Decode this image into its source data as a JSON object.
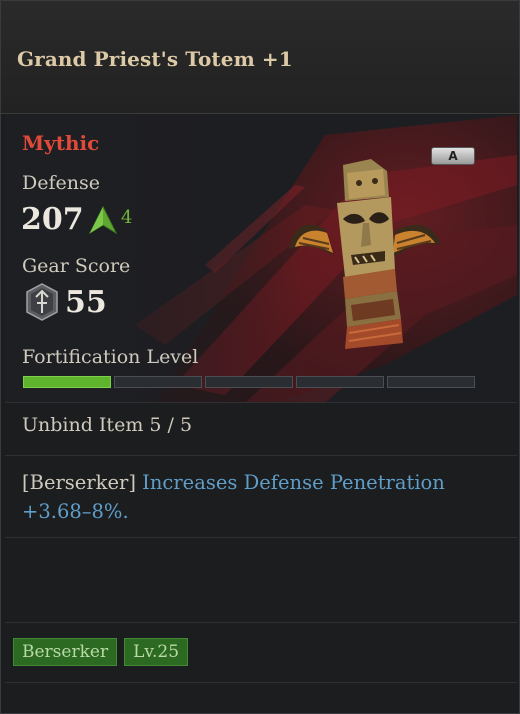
{
  "item": {
    "name": "Grand Priest's Totem +1",
    "rarity": "Mythic",
    "rarity_color": "#e04a3b",
    "grade_badge": "A",
    "icon": "totem-icon"
  },
  "stats": {
    "defense_label": "Defense",
    "defense_value": "207",
    "defense_delta": "4",
    "gear_score_label": "Gear Score",
    "gear_score_value": "55",
    "fortification_label": "Fortification Level",
    "fortification_filled": 1,
    "fortification_total": 5
  },
  "unbind": "Unbind Item 5 / 5",
  "effect": {
    "class_tag": "[Berserker]",
    "text": "Increases Defense Penetration",
    "value": "+3.68–8%."
  },
  "tags": [
    "Berserker",
    "Lv.25"
  ]
}
